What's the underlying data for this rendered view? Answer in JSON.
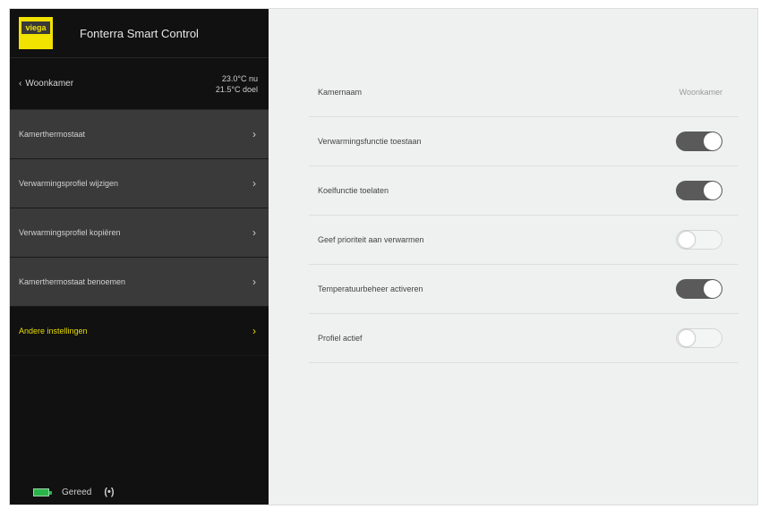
{
  "app": {
    "logo_text": "viega",
    "title": "Fonterra Smart Control"
  },
  "back": {
    "label": "Woonkamer",
    "current_temp": "23.0°C nu",
    "target_temp": "21.5°C doel"
  },
  "sidebar": {
    "items": [
      {
        "label": "Kamerthermostaat"
      },
      {
        "label": "Verwarmingsprofiel wijzigen"
      },
      {
        "label": "Verwarmingsprofiel kopiëren"
      },
      {
        "label": "Kamerthermostaat benoemen"
      },
      {
        "label": "Andere instellingen",
        "active": true
      }
    ]
  },
  "footer": {
    "status_label": "Gereed",
    "signal_text": "(•)"
  },
  "settings": {
    "room_name_label": "Kamernaam",
    "room_name_value": "Woonkamer",
    "rows": [
      {
        "label": "Verwarmingsfunctie toestaan",
        "on": true
      },
      {
        "label": "Koelfunctie toelaten",
        "on": true
      },
      {
        "label": "Geef prioriteit aan verwarmen",
        "on": false
      },
      {
        "label": "Temperatuurbeheer activeren",
        "on": true
      },
      {
        "label": "Profiel actief",
        "on": false
      }
    ]
  },
  "colors": {
    "accent": "#e8dd00",
    "sidebar_bg": "#111111",
    "sidebar_item_bg": "#3a3a3a",
    "main_bg": "#eff1f1",
    "toggle_on": "#5a5a5a"
  }
}
